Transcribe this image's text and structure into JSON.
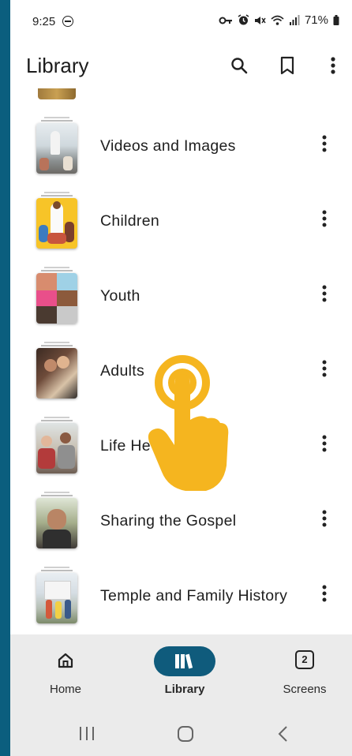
{
  "status_bar": {
    "time": "9:25",
    "battery": "71%",
    "icons": [
      "vpn-key-icon",
      "alarm-icon",
      "mute-icon",
      "wifi-icon",
      "signal-icon",
      "battery-icon"
    ]
  },
  "app_bar": {
    "title": "Library",
    "actions": [
      "search-icon",
      "bookmark-icon",
      "more-vert-icon"
    ]
  },
  "library_items": [
    {
      "label": "Videos and Images"
    },
    {
      "label": "Children"
    },
    {
      "label": "Youth"
    },
    {
      "label": "Adults"
    },
    {
      "label": "Life He"
    },
    {
      "label": "Sharing the Gospel"
    },
    {
      "label": "Temple and Family History"
    }
  ],
  "bottom_nav": {
    "home": "Home",
    "library": "Library",
    "screens": "Screens",
    "screens_count": "2",
    "active": "library"
  },
  "colors": {
    "accent": "#0f5b7c",
    "frame": "#0b5e7e",
    "pointer": "#f5b51f"
  }
}
